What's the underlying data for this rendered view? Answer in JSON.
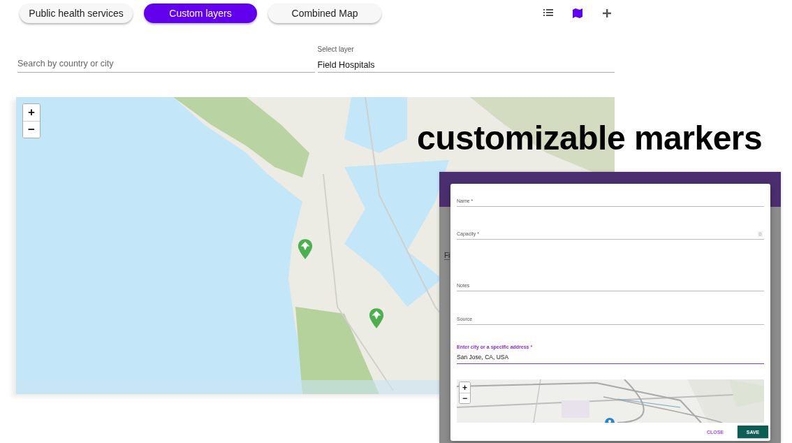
{
  "tabs": [
    {
      "label": "Public health services",
      "selected": false
    },
    {
      "label": "Custom layers",
      "selected": true
    },
    {
      "label": "Combined Map",
      "selected": false
    }
  ],
  "view_icons": [
    {
      "kind": "list",
      "selected": false
    },
    {
      "kind": "map",
      "selected": true
    },
    {
      "kind": "add",
      "selected": false
    }
  ],
  "search": {
    "placeholder": "Search by country or city"
  },
  "layer_select": {
    "label": "Select layer",
    "value": "Field Hospitals"
  },
  "map": {
    "zoom_in": "+",
    "zoom_out": "−"
  },
  "caption": "customizable markers",
  "dialog_window": {
    "background_value": "Fi"
  },
  "dialog": {
    "fields": [
      {
        "label": "Name *",
        "kind": "text",
        "focused": false
      },
      {
        "label": "Capacity *",
        "kind": "number",
        "focused": false
      },
      {
        "label": "Notes",
        "kind": "textarea",
        "focused": false
      },
      {
        "label": "Source",
        "kind": "text",
        "focused": false
      },
      {
        "label": "Enter city or a specific address",
        "required_mark": "*",
        "kind": "text",
        "focused": true,
        "value": "San Jose, CA, USA"
      }
    ],
    "mini_map": {
      "zoom_in": "+",
      "zoom_out": "−"
    },
    "buttons": [
      {
        "label": "CLOSE",
        "kind": "text"
      },
      {
        "label": "SAVE",
        "kind": "filled"
      }
    ]
  }
}
